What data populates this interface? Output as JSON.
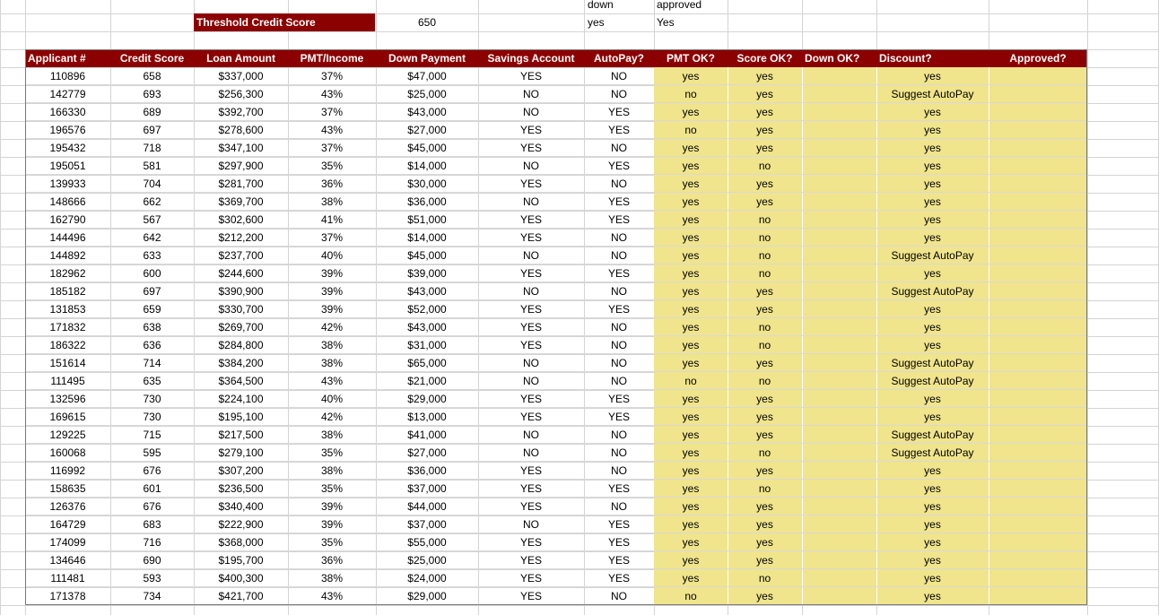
{
  "top_labels": {
    "down_header": "down",
    "approved_header": "approved",
    "down_value": "yes",
    "approved_value": "Yes"
  },
  "threshold": {
    "label": "Threshold Credit Score",
    "value": "650"
  },
  "table": {
    "headers": [
      "Applicant #",
      "Credit Score",
      "Loan Amount",
      "PMT/Income",
      "Down Payment",
      "Savings Account",
      "AutoPay?",
      "PMT OK?",
      "Score OK?",
      "Down OK?",
      "Discount?",
      "Approved?"
    ],
    "rows": [
      [
        "110896",
        "658",
        "$337,000",
        "37%",
        "$47,000",
        "YES",
        "NO",
        "yes",
        "yes",
        "",
        "yes",
        ""
      ],
      [
        "142779",
        "693",
        "$256,300",
        "43%",
        "$25,000",
        "NO",
        "NO",
        "no",
        "yes",
        "",
        "Suggest AutoPay",
        ""
      ],
      [
        "166330",
        "689",
        "$392,700",
        "37%",
        "$43,000",
        "NO",
        "YES",
        "yes",
        "yes",
        "",
        "yes",
        ""
      ],
      [
        "196576",
        "697",
        "$278,600",
        "43%",
        "$27,000",
        "YES",
        "YES",
        "no",
        "yes",
        "",
        "yes",
        ""
      ],
      [
        "195432",
        "718",
        "$347,100",
        "37%",
        "$45,000",
        "YES",
        "NO",
        "yes",
        "yes",
        "",
        "yes",
        ""
      ],
      [
        "195051",
        "581",
        "$297,900",
        "35%",
        "$14,000",
        "NO",
        "YES",
        "yes",
        "no",
        "",
        "yes",
        ""
      ],
      [
        "139933",
        "704",
        "$281,700",
        "36%",
        "$30,000",
        "YES",
        "NO",
        "yes",
        "yes",
        "",
        "yes",
        ""
      ],
      [
        "148666",
        "662",
        "$369,700",
        "38%",
        "$36,000",
        "NO",
        "YES",
        "yes",
        "yes",
        "",
        "yes",
        ""
      ],
      [
        "162790",
        "567",
        "$302,600",
        "41%",
        "$51,000",
        "YES",
        "YES",
        "yes",
        "no",
        "",
        "yes",
        ""
      ],
      [
        "144496",
        "642",
        "$212,200",
        "37%",
        "$14,000",
        "YES",
        "NO",
        "yes",
        "no",
        "",
        "yes",
        ""
      ],
      [
        "144892",
        "633",
        "$237,700",
        "40%",
        "$45,000",
        "NO",
        "NO",
        "yes",
        "no",
        "",
        "Suggest AutoPay",
        ""
      ],
      [
        "182962",
        "600",
        "$244,600",
        "39%",
        "$39,000",
        "YES",
        "YES",
        "yes",
        "no",
        "",
        "yes",
        ""
      ],
      [
        "185182",
        "697",
        "$390,900",
        "39%",
        "$43,000",
        "NO",
        "NO",
        "yes",
        "yes",
        "",
        "Suggest AutoPay",
        ""
      ],
      [
        "131853",
        "659",
        "$330,700",
        "39%",
        "$52,000",
        "YES",
        "YES",
        "yes",
        "yes",
        "",
        "yes",
        ""
      ],
      [
        "171832",
        "638",
        "$269,700",
        "42%",
        "$43,000",
        "YES",
        "NO",
        "yes",
        "no",
        "",
        "yes",
        ""
      ],
      [
        "186322",
        "636",
        "$284,800",
        "38%",
        "$31,000",
        "YES",
        "NO",
        "yes",
        "no",
        "",
        "yes",
        ""
      ],
      [
        "151614",
        "714",
        "$384,200",
        "38%",
        "$65,000",
        "NO",
        "NO",
        "yes",
        "yes",
        "",
        "Suggest AutoPay",
        ""
      ],
      [
        "111495",
        "635",
        "$364,500",
        "43%",
        "$21,000",
        "NO",
        "NO",
        "no",
        "no",
        "",
        "Suggest AutoPay",
        ""
      ],
      [
        "132596",
        "730",
        "$224,100",
        "40%",
        "$29,000",
        "YES",
        "YES",
        "yes",
        "yes",
        "",
        "yes",
        ""
      ],
      [
        "169615",
        "730",
        "$195,100",
        "42%",
        "$13,000",
        "YES",
        "YES",
        "yes",
        "yes",
        "",
        "yes",
        ""
      ],
      [
        "129225",
        "715",
        "$217,500",
        "38%",
        "$41,000",
        "NO",
        "NO",
        "yes",
        "yes",
        "",
        "Suggest AutoPay",
        ""
      ],
      [
        "160068",
        "595",
        "$279,100",
        "35%",
        "$27,000",
        "NO",
        "NO",
        "yes",
        "no",
        "",
        "Suggest AutoPay",
        ""
      ],
      [
        "116992",
        "676",
        "$307,200",
        "38%",
        "$36,000",
        "YES",
        "NO",
        "yes",
        "yes",
        "",
        "yes",
        ""
      ],
      [
        "158635",
        "601",
        "$236,500",
        "35%",
        "$37,000",
        "YES",
        "YES",
        "yes",
        "no",
        "",
        "yes",
        ""
      ],
      [
        "126376",
        "676",
        "$340,400",
        "39%",
        "$44,000",
        "YES",
        "NO",
        "yes",
        "yes",
        "",
        "yes",
        ""
      ],
      [
        "164729",
        "683",
        "$222,900",
        "39%",
        "$37,000",
        "NO",
        "YES",
        "yes",
        "yes",
        "",
        "yes",
        ""
      ],
      [
        "174099",
        "716",
        "$368,000",
        "35%",
        "$55,000",
        "YES",
        "YES",
        "yes",
        "yes",
        "",
        "yes",
        ""
      ],
      [
        "134646",
        "690",
        "$195,700",
        "36%",
        "$25,000",
        "YES",
        "YES",
        "yes",
        "yes",
        "",
        "yes",
        ""
      ],
      [
        "111481",
        "593",
        "$400,300",
        "38%",
        "$24,000",
        "YES",
        "YES",
        "yes",
        "no",
        "",
        "yes",
        ""
      ],
      [
        "171378",
        "734",
        "$421,700",
        "43%",
        "$29,000",
        "YES",
        "NO",
        "no",
        "yes",
        "",
        "yes",
        ""
      ]
    ]
  },
  "colors": {
    "header_bg": "#8b0000",
    "header_text": "#ffffff",
    "computed_bg": "#f0e48c",
    "gridline": "#d4d4d4"
  }
}
